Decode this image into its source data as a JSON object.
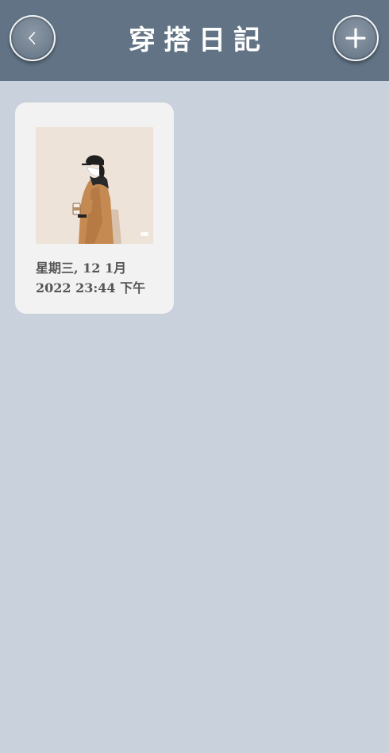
{
  "header": {
    "title": "穿搭日記",
    "back_icon": "chevron-left-icon",
    "add_icon": "plus-icon"
  },
  "entries": [
    {
      "date_line1": "星期三, 12 1月",
      "date_line2": "2022 23:44 下午",
      "image": "illustration of person in cap, mask and camel coat holding a drink"
    }
  ],
  "colors": {
    "header_bg": "#617385",
    "page_bg": "#c9d1dc",
    "card_bg": "#f2f2f2",
    "text_dark": "#555555"
  }
}
